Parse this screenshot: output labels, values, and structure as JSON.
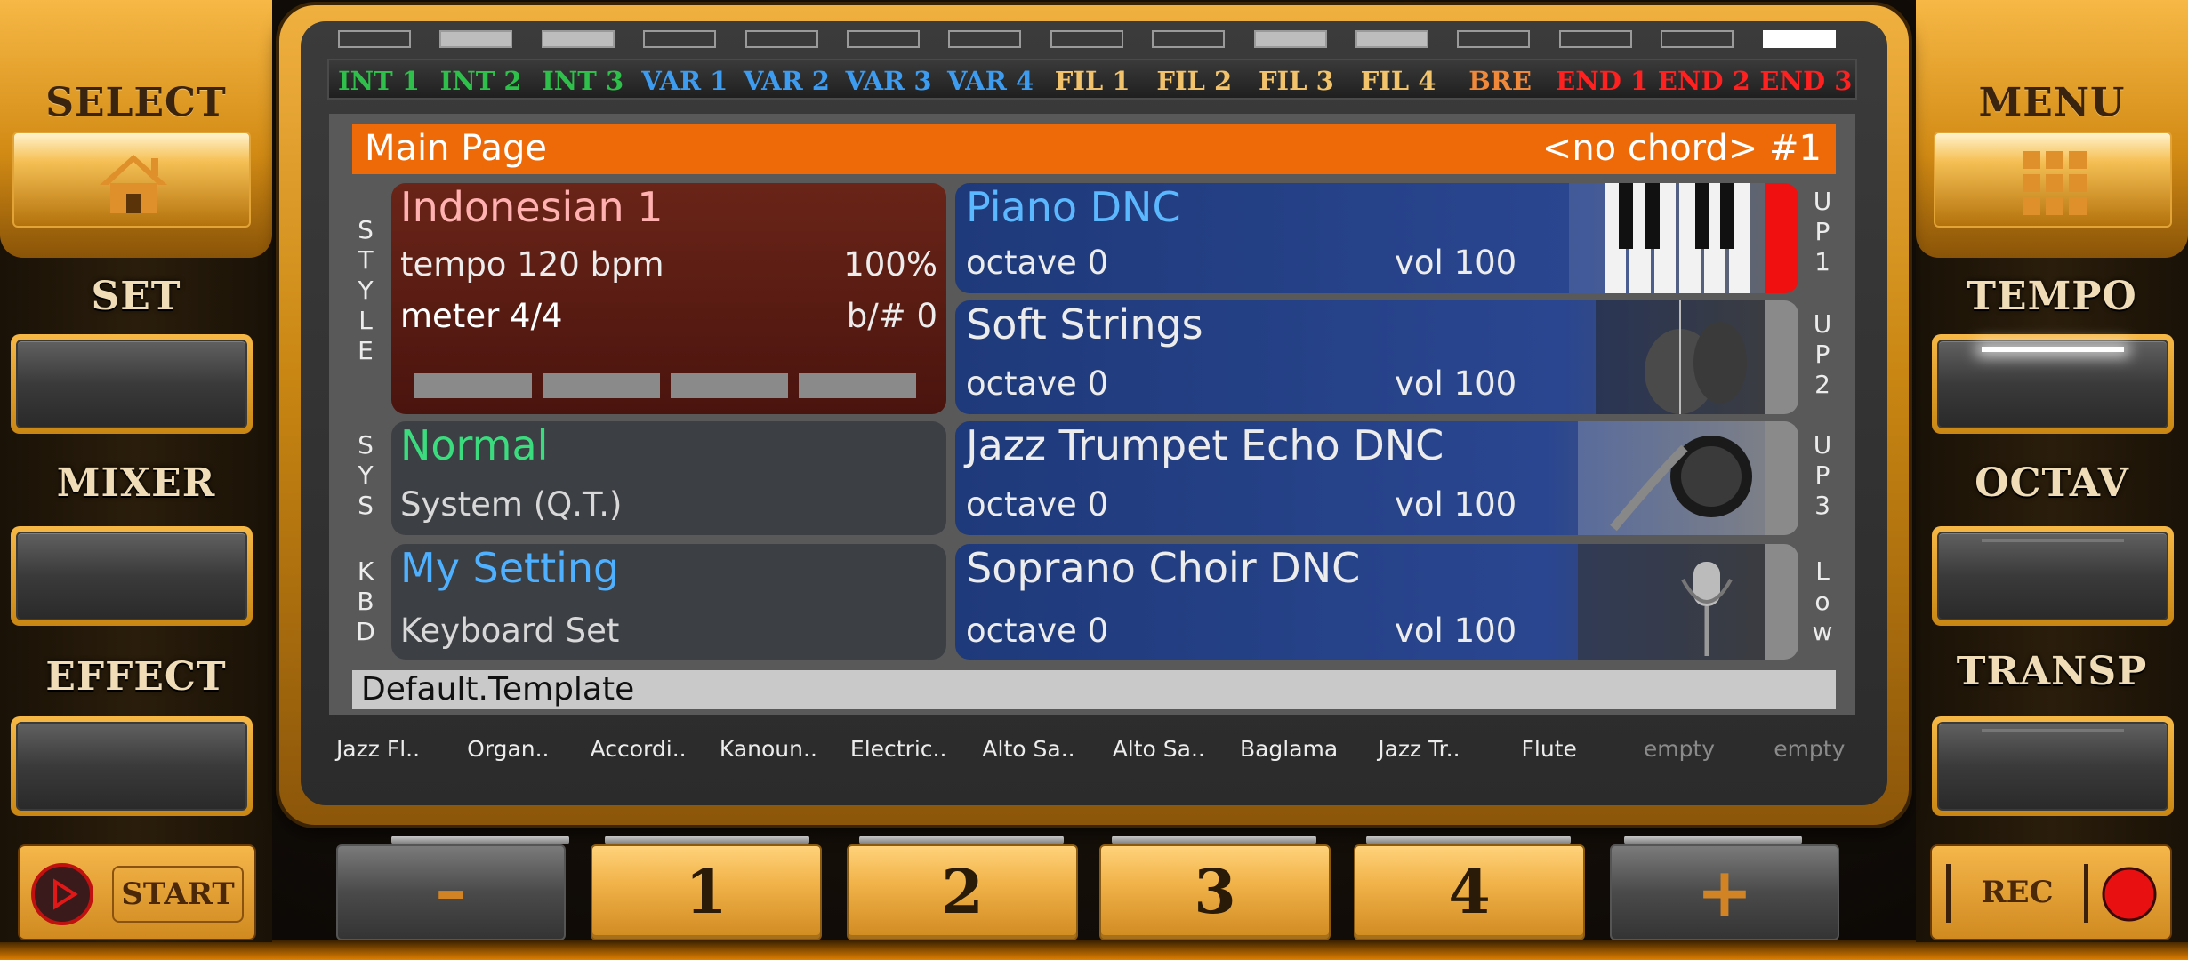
{
  "left_panel": {
    "select_label": "SELECT",
    "select_icon": "home-icon",
    "set_label": "SET",
    "mixer_label": "MIXER",
    "effect_label": "EFFECT",
    "start_label": "START"
  },
  "right_panel": {
    "menu_label": "MENU",
    "menu_icon": "grid-icon",
    "tempo_label": "TEMPO",
    "octav_label": "OCTAV",
    "transp_label": "TRANSP",
    "rec_label": "REC"
  },
  "section_lights": [
    false,
    true,
    true,
    false,
    false,
    false,
    false,
    false,
    false,
    true,
    true,
    false,
    false,
    false,
    "white"
  ],
  "sections": [
    {
      "label": "INT 1",
      "color": "#2ec04a"
    },
    {
      "label": "INT 2",
      "color": "#2ec04a"
    },
    {
      "label": "INT 3",
      "color": "#2ec04a"
    },
    {
      "label": "VAR 1",
      "color": "#3d9cf0"
    },
    {
      "label": "VAR 2",
      "color": "#3d9cf0"
    },
    {
      "label": "VAR 3",
      "color": "#3d9cf0"
    },
    {
      "label": "VAR 4",
      "color": "#3d9cf0"
    },
    {
      "label": "FIL 1",
      "color": "#f2c36b"
    },
    {
      "label": "FIL 2",
      "color": "#f2c36b"
    },
    {
      "label": "FIL 3",
      "color": "#f2c36b"
    },
    {
      "label": "FIL 4",
      "color": "#f2c36b"
    },
    {
      "label": "BRE",
      "color": "#f0893a"
    },
    {
      "label": "END 1",
      "color": "#ff2020"
    },
    {
      "label": "END 2",
      "color": "#ff2020"
    },
    {
      "label": "END 3",
      "color": "#ff2020"
    }
  ],
  "main_page": {
    "title": "Main Page",
    "chord": "<no chord> #1"
  },
  "style": {
    "side_label": [
      "S",
      "T",
      "Y",
      "L",
      "E"
    ],
    "name": "Indonesian 1",
    "tempo": "tempo 120 bpm",
    "tempo_pct": "100%",
    "meter": "meter 4/4",
    "key": "b/#  0"
  },
  "sys": {
    "side_label": [
      "S",
      "Y",
      "S"
    ],
    "name": "Normal",
    "sub": "System (Q.T.)"
  },
  "kbd": {
    "side_label": [
      "K",
      "B",
      "D"
    ],
    "name": "My Setting",
    "sub": "Keyboard Set"
  },
  "voices": [
    {
      "name": "Piano DNC",
      "octave": "octave  0",
      "vol": "vol 100",
      "side": [
        "U",
        "P",
        "1"
      ],
      "image": "piano-keys-icon",
      "name_color": "#5bb8ff"
    },
    {
      "name": "Soft Strings",
      "octave": "octave  0",
      "vol": "vol 100",
      "side": [
        "U",
        "P",
        "2"
      ],
      "image": "violin-icon",
      "name_color": "#ececec"
    },
    {
      "name": "Jazz Trumpet Echo DNC",
      "octave": "octave  0",
      "vol": "vol 100",
      "side": [
        "U",
        "P",
        "3"
      ],
      "image": "saxophone-icon",
      "name_color": "#ececec"
    },
    {
      "name": "Soprano Choir DNC",
      "octave": "octave  0",
      "vol": "vol 100",
      "side": [
        "L",
        "o",
        "w"
      ],
      "image": "microphone-icon",
      "name_color": "#ececec"
    }
  ],
  "template": "Default.Template",
  "shortcuts": [
    {
      "label": "Jazz Fl..",
      "empty": false
    },
    {
      "label": "Organ..",
      "empty": false
    },
    {
      "label": "Accordi..",
      "empty": false
    },
    {
      "label": "Kanoun..",
      "empty": false
    },
    {
      "label": "Electric..",
      "empty": false
    },
    {
      "label": "Alto Sa..",
      "empty": false
    },
    {
      "label": "Alto Sa..",
      "empty": false
    },
    {
      "label": "Baglama",
      "empty": false
    },
    {
      "label": "Jazz Tr..",
      "empty": false
    },
    {
      "label": "Flute",
      "empty": false
    },
    {
      "label": "empty",
      "empty": true
    },
    {
      "label": "empty",
      "empty": true
    }
  ],
  "bottom": {
    "minus_label": "–",
    "btn1": "1",
    "btn2": "2",
    "btn3": "3",
    "btn4": "4",
    "plus_label": "+"
  },
  "colors": {
    "accent_orange": "#ee6a08",
    "gold": "#f1b34a",
    "style_panel": "#5a1a12",
    "voice_panel": "#203a78",
    "gray_panel": "#3c3f44",
    "sys_name": "#3bdc7e",
    "kbd_name": "#4fb0ff",
    "style_name": "#ffb0b0"
  }
}
